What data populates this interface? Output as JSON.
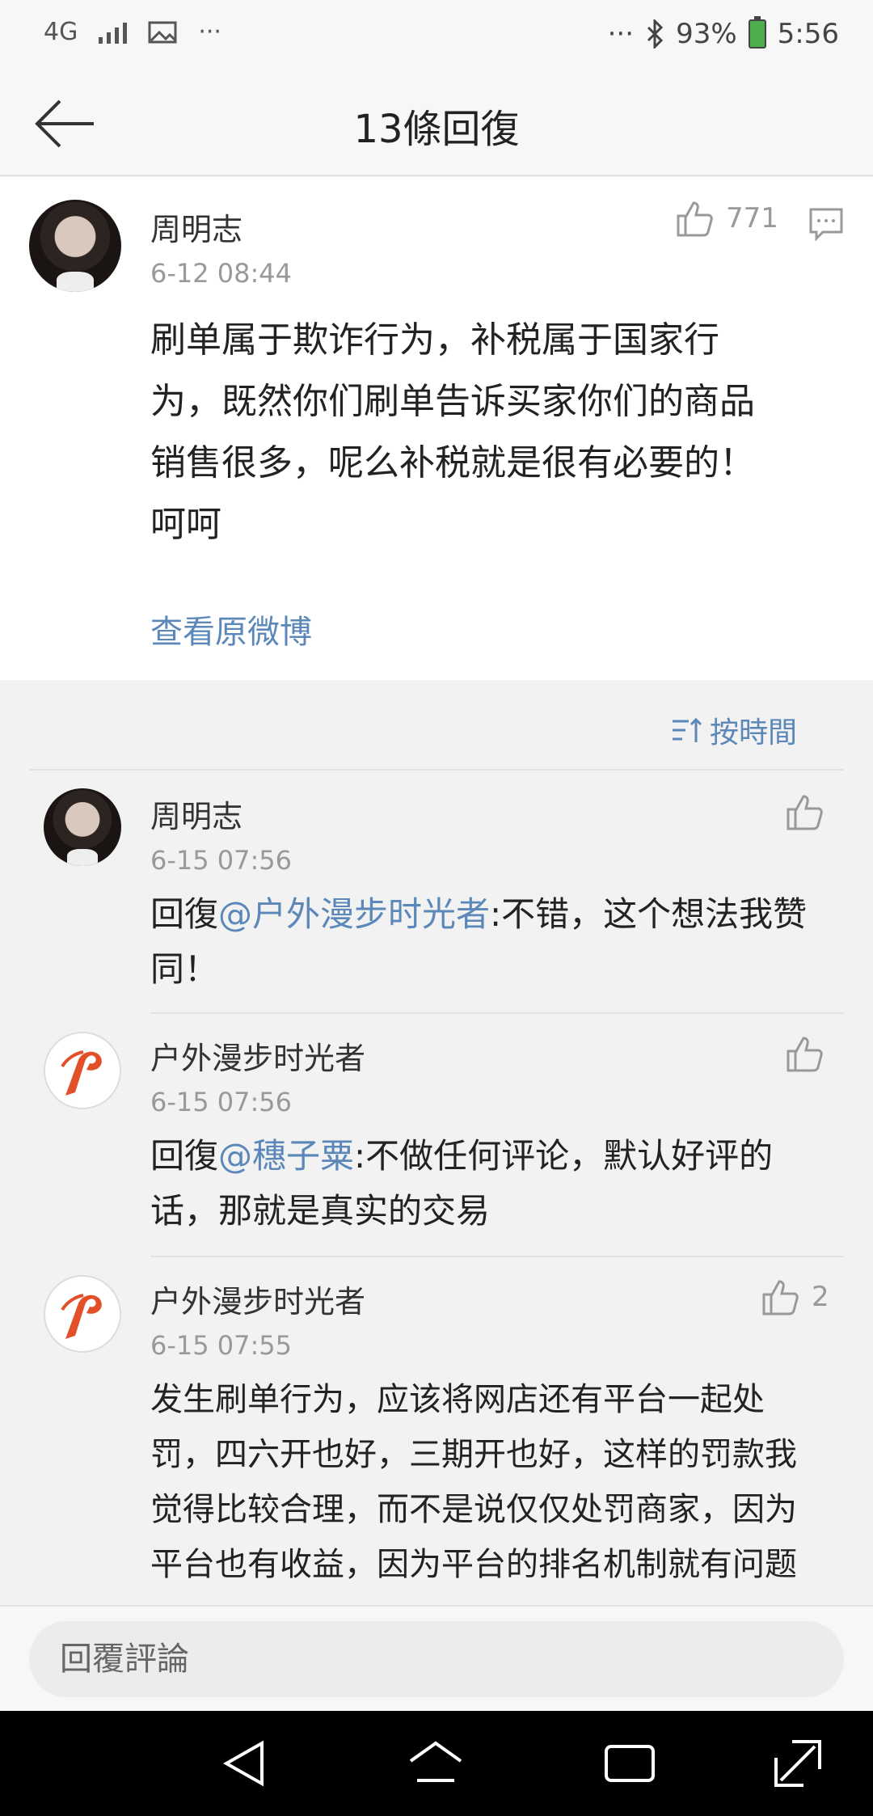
{
  "status": {
    "network": "4G",
    "dots_left": "···",
    "dots_right": "···",
    "battery": "93%",
    "time": "5:56"
  },
  "header": {
    "title": "13條回復"
  },
  "main_post": {
    "author": "周明志",
    "time": "6-12 08:44",
    "likes": "771",
    "text_lines": [
      "刷单属于欺诈行为，补税属于国家行",
      "为，既然你们刷单告诉买家你们的商品",
      "销售很多，呢么补税就是很有必要的！",
      "呵呵"
    ],
    "view_original": "查看原微博"
  },
  "sort": {
    "label": "按時間"
  },
  "replies": [
    {
      "author": "周明志",
      "time": "6-15 07:56",
      "prefix": "回復",
      "mention": "@户外漫步时光者",
      "line1_rest": ":不错，这个想法我赞",
      "line2": "同！",
      "likes": ""
    },
    {
      "author": "户外漫步时光者",
      "time": "6-15 07:56",
      "prefix": "回復",
      "mention": "@穗子粟",
      "line1_rest": ":不做任何评论，默认好评的",
      "line2": "话，那就是真实的交易",
      "likes": ""
    },
    {
      "author": "户外漫步时光者",
      "time": "6-15 07:55",
      "lines": [
        "发生刷单行为，应该将网店还有平台一起处",
        "罚，四六开也好，三期开也好，这样的罚款我",
        "觉得比较合理，而不是说仅仅处罚商家，因为",
        "平台也有收益，因为平台的排名机制就有问题"
      ],
      "likes": "2"
    }
  ],
  "input": {
    "placeholder": "回覆評論"
  }
}
